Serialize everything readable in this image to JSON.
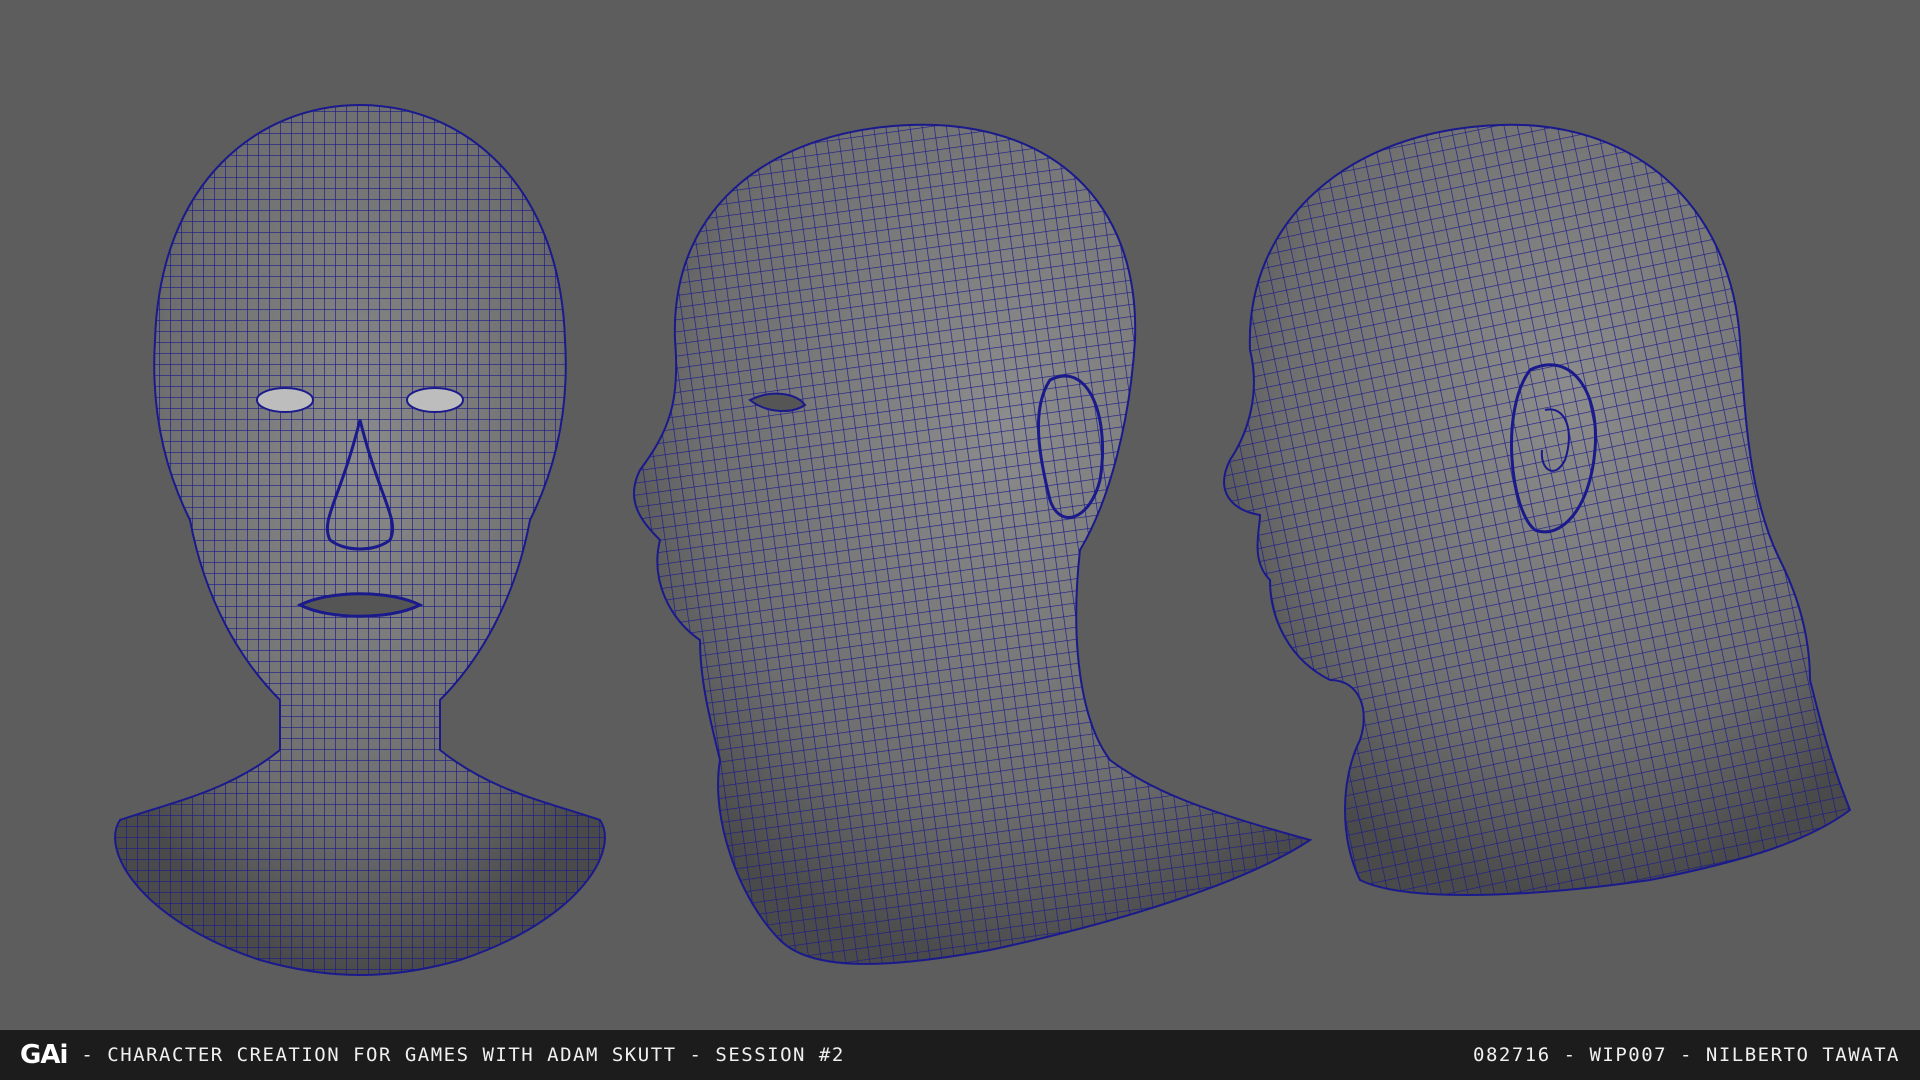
{
  "footer": {
    "logo_text": "GAi",
    "session_text": "- CHARACTER CREATION FOR GAMES WITH ADAM SKUTT - SESSION #2",
    "credit_text": "082716 - WIP007 - NILBERTO TAWATA"
  },
  "viewport": {
    "background_color": "#5d5d5d",
    "surface_color": "#777777",
    "wireframe_color": "#1a1a8c",
    "views": [
      "front-view",
      "three-quarter-view",
      "side-view"
    ]
  }
}
